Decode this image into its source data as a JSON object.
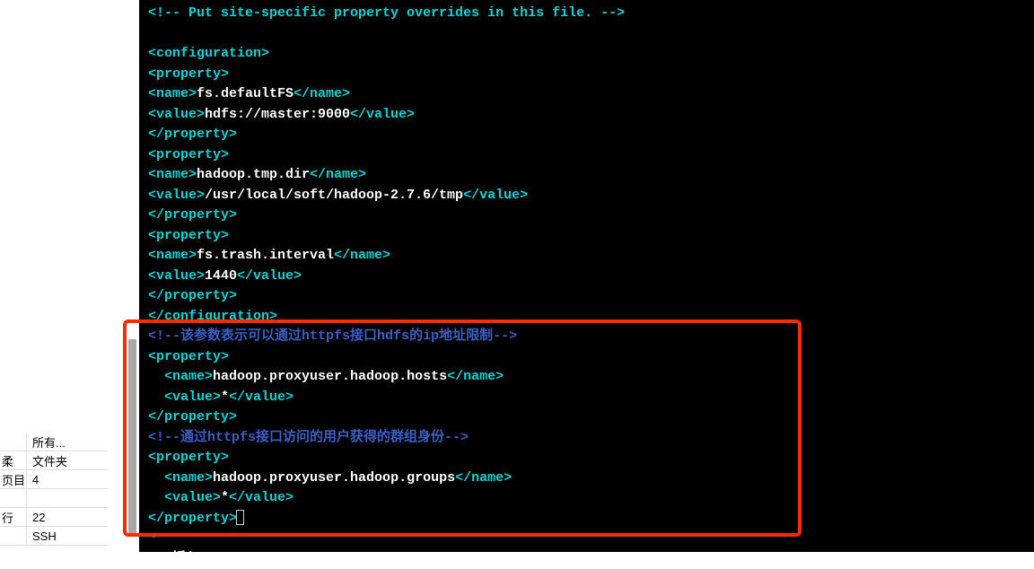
{
  "sidebar": {
    "rows": [
      {
        "c1": "",
        "c2": "所有..."
      },
      {
        "c1": "柔",
        "c2": "文件夹"
      },
      {
        "c1": "页目",
        "c2": "4"
      },
      {
        "c1": "",
        "c2": ""
      },
      {
        "c1": "行",
        "c2": "22"
      },
      {
        "c1": "",
        "c2": "SSH"
      }
    ]
  },
  "terminal": {
    "lines": [
      {
        "segments": [
          {
            "cls": "tag",
            "t": "<!-- Put site-specific property overrides in this file. -->"
          }
        ]
      },
      {
        "segments": [
          {
            "cls": "txt",
            "t": " "
          }
        ]
      },
      {
        "segments": [
          {
            "cls": "tag",
            "t": "<configuration>"
          }
        ]
      },
      {
        "segments": [
          {
            "cls": "tag",
            "t": "<property>"
          }
        ]
      },
      {
        "segments": [
          {
            "cls": "tag",
            "t": "<name>"
          },
          {
            "cls": "txt",
            "t": "fs.defaultFS"
          },
          {
            "cls": "tag",
            "t": "</name>"
          }
        ]
      },
      {
        "segments": [
          {
            "cls": "tag",
            "t": "<value>"
          },
          {
            "cls": "txt",
            "t": "hdfs://master:9000"
          },
          {
            "cls": "tag",
            "t": "</value>"
          }
        ]
      },
      {
        "segments": [
          {
            "cls": "tag",
            "t": "</property>"
          }
        ]
      },
      {
        "segments": [
          {
            "cls": "tag",
            "t": "<property>"
          }
        ]
      },
      {
        "segments": [
          {
            "cls": "tag",
            "t": "<name>"
          },
          {
            "cls": "txt",
            "t": "hadoop.tmp.dir"
          },
          {
            "cls": "tag",
            "t": "</name>"
          }
        ]
      },
      {
        "segments": [
          {
            "cls": "tag",
            "t": "<value>"
          },
          {
            "cls": "txt",
            "t": "/usr/local/soft/hadoop-2.7.6/tmp"
          },
          {
            "cls": "tag",
            "t": "</value>"
          }
        ]
      },
      {
        "segments": [
          {
            "cls": "tag",
            "t": "</property>"
          }
        ]
      },
      {
        "segments": [
          {
            "cls": "tag",
            "t": "<property>"
          }
        ]
      },
      {
        "segments": [
          {
            "cls": "tag",
            "t": "<name>"
          },
          {
            "cls": "txt",
            "t": "fs.trash.interval"
          },
          {
            "cls": "tag",
            "t": "</name>"
          }
        ]
      },
      {
        "segments": [
          {
            "cls": "tag",
            "t": "<value>"
          },
          {
            "cls": "txt",
            "t": "1440"
          },
          {
            "cls": "tag",
            "t": "</value>"
          }
        ]
      },
      {
        "segments": [
          {
            "cls": "tag",
            "t": "</property>"
          }
        ]
      },
      {
        "segments": [
          {
            "cls": "tag",
            "t": "</configuration>"
          }
        ]
      },
      {
        "segments": [
          {
            "cls": "blue-cm",
            "t": "<!--该参数表示可以通过"
          },
          {
            "cls": "blue-kw",
            "t": "httpfs"
          },
          {
            "cls": "blue-cm",
            "t": "接口"
          },
          {
            "cls": "blue-kw",
            "t": "hdfs"
          },
          {
            "cls": "blue-cm",
            "t": "的"
          },
          {
            "cls": "blue-kw",
            "t": "ip"
          },
          {
            "cls": "blue-cm",
            "t": "地址限制"
          },
          {
            "cls": "blue-cm",
            "t": "-->"
          }
        ]
      },
      {
        "segments": [
          {
            "cls": "tag",
            "t": "<property>"
          }
        ]
      },
      {
        "segments": [
          {
            "cls": "txt",
            "t": "  "
          },
          {
            "cls": "tag",
            "t": "<name>"
          },
          {
            "cls": "txt",
            "t": "hadoop.proxyuser.hadoop.hosts"
          },
          {
            "cls": "tag",
            "t": "</name>"
          }
        ]
      },
      {
        "segments": [
          {
            "cls": "txt",
            "t": "  "
          },
          {
            "cls": "tag",
            "t": "<value>"
          },
          {
            "cls": "txt",
            "t": "*"
          },
          {
            "cls": "tag",
            "t": "</value>"
          }
        ]
      },
      {
        "segments": [
          {
            "cls": "tag",
            "t": "</property>"
          }
        ]
      },
      {
        "segments": [
          {
            "cls": "blue-cm",
            "t": "<!--通过"
          },
          {
            "cls": "blue-kw",
            "t": "httpfs"
          },
          {
            "cls": "blue-cm",
            "t": "接口访问的用户获得的群组身份"
          },
          {
            "cls": "blue-cm",
            "t": "-->"
          }
        ]
      },
      {
        "segments": [
          {
            "cls": "tag",
            "t": "<property>"
          }
        ]
      },
      {
        "segments": [
          {
            "cls": "txt",
            "t": "  "
          },
          {
            "cls": "tag",
            "t": "<name>"
          },
          {
            "cls": "txt",
            "t": "hadoop.proxyuser.hadoop.groups"
          },
          {
            "cls": "tag",
            "t": "</name>"
          }
        ]
      },
      {
        "segments": [
          {
            "cls": "txt",
            "t": "  "
          },
          {
            "cls": "tag",
            "t": "<value>"
          },
          {
            "cls": "txt",
            "t": "*"
          },
          {
            "cls": "tag",
            "t": "</value>"
          }
        ]
      },
      {
        "segments": [
          {
            "cls": "tag",
            "t": "</property>"
          }
        ],
        "cursor": true
      },
      {
        "segments": [
          {
            "cls": "blue-cm",
            "t": "~"
          }
        ]
      },
      {
        "segments": [
          {
            "cls": "txt",
            "t": "-- 插入 --"
          }
        ]
      }
    ]
  }
}
